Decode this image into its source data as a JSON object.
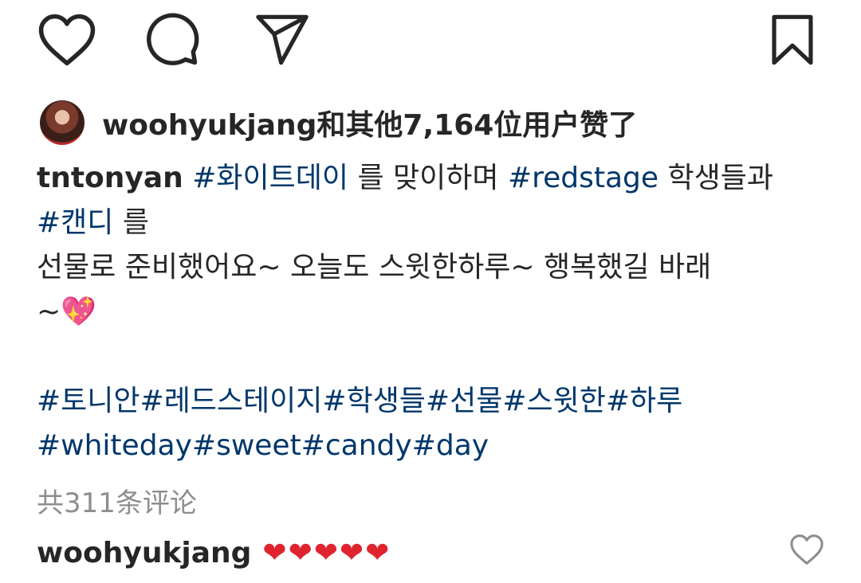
{
  "actions": {
    "like_icon": "heart-outline-icon",
    "comment_icon": "comment-bubble-icon",
    "share_icon": "paper-plane-icon",
    "save_icon": "bookmark-icon"
  },
  "likes": {
    "username": "woohyukjang",
    "text": "和其他7,164位用户赞了"
  },
  "caption": {
    "username": "tntonyan",
    "line1_tag1": "#화이트데이",
    "line1_text1": " 를 맞이하며 ",
    "line1_tag2": "#redstage",
    "line1_text2": " 학생들과",
    "line2_tag": "#캔디",
    "line2_text": " 를",
    "line3": "선물로 준비했어요~ 오늘도 스윗한하루~ 행복했길 바래",
    "line4": "~💖",
    "hashtags_line1": "#토니안#레드스테이지#학생들#선물#스윗한#하루",
    "hashtags_line2": "#whiteday#sweet#candy#day"
  },
  "comments": {
    "count_text": "共311条评论",
    "first": {
      "username": "woohyukjang",
      "text": "❤❤❤❤❤"
    }
  },
  "colors": {
    "text": "#262626",
    "hashtag": "#00376b",
    "muted": "#8e8e8e",
    "heart": "#e0242f"
  }
}
